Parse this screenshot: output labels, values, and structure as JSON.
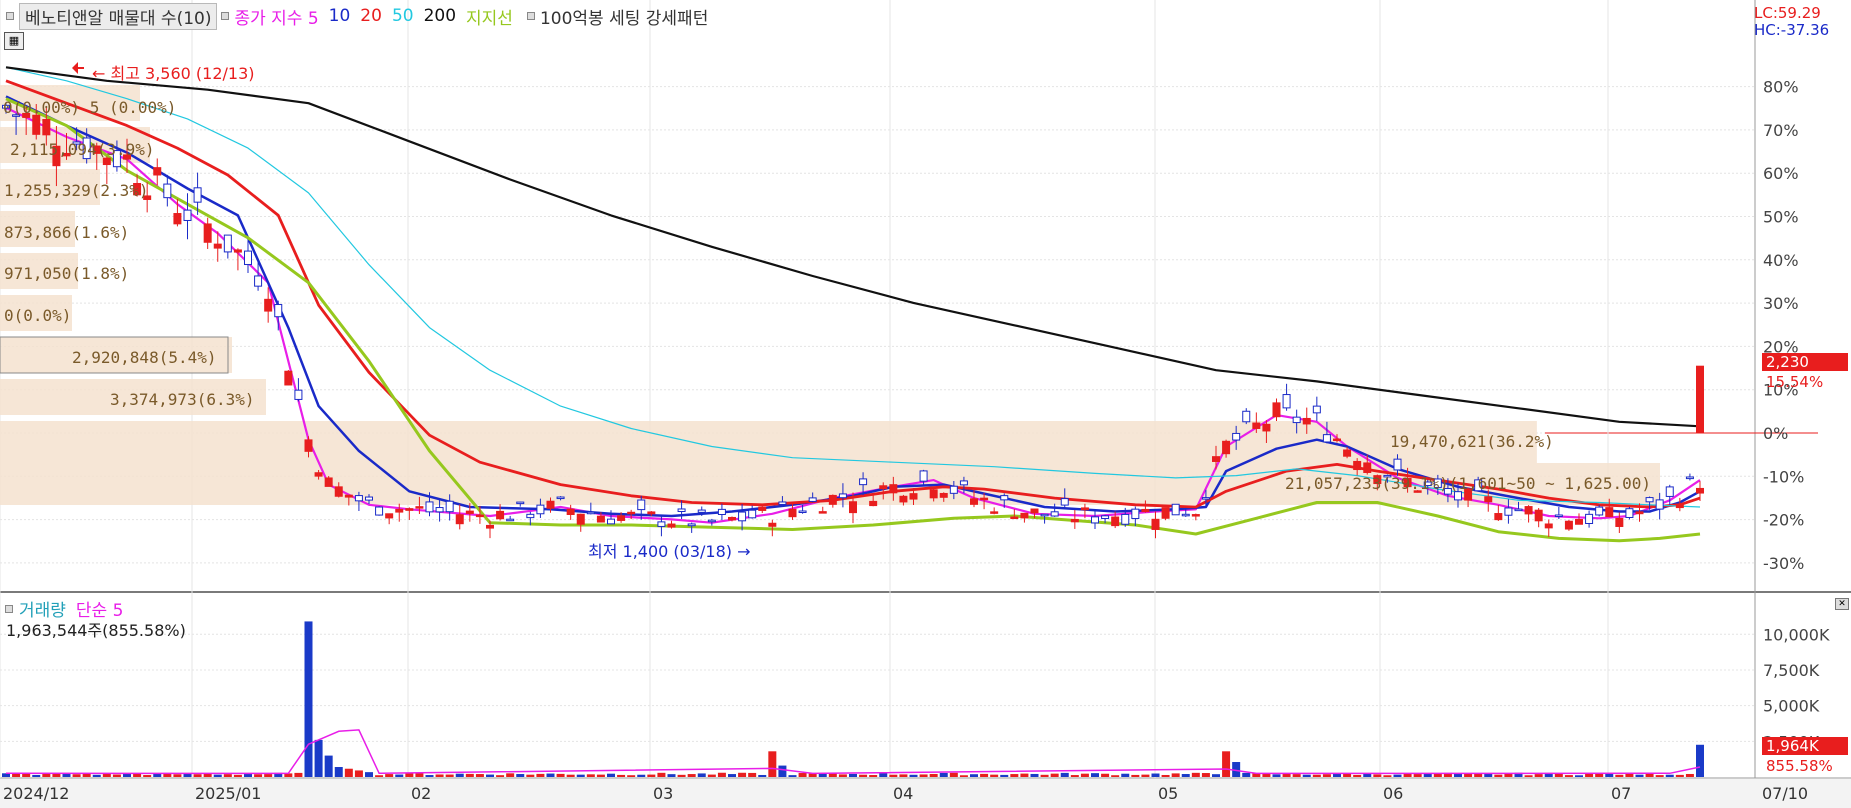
{
  "legend": {
    "title": "베노티앤알 매물대 수(10)",
    "items": [
      {
        "label": "종가 지수 5",
        "color": "#e81ee8"
      },
      {
        "label": "10",
        "color": "#1a2ac8"
      },
      {
        "label": "20",
        "color": "#e81e1e"
      },
      {
        "label": "50",
        "color": "#22c8e0"
      },
      {
        "label": "200",
        "color": "#111111"
      },
      {
        "label": "지지선",
        "color": "#96c81e"
      },
      {
        "label": "100억봉 세팅 강세패턴",
        "color": "#333333"
      }
    ]
  },
  "lc_label": "LC:59.29",
  "hc_label": "HC:-37.36",
  "price_tag": "2,230",
  "pct_tag": "15.54%",
  "volume_legend": {
    "label1": "거래량",
    "label2": "단순 5"
  },
  "volume_info": "1,963,544주(855.58%)",
  "volume_tag": "1,964K",
  "volume_pct_tag": "855.58%",
  "annotations": {
    "high": "최고 3,560 (12/13)",
    "low": "최저 1,400 (03/18)"
  },
  "profile_labels": [
    "0(0.00%) 5 (0.00%)",
    "2,115,094(3.9%)",
    "1,255,329(2.3%)",
    "873,866(1.6%)",
    "971,050(1.8%)",
    "0(0.0%)",
    "2,920,848(5.4%)",
    "3,374,973(6.3%)",
    "19,470,621(36.2%)",
    "21,057,233(39.1%)(1,601~50 ~ 1,625.00)"
  ],
  "chart_data": {
    "type": "candlestick+volume",
    "price_axis_ticks": [
      "80%",
      "70%",
      "60%",
      "50%",
      "40%",
      "30%",
      "20%",
      "10%",
      "0%",
      "-10%",
      "-20%",
      "-30%"
    ],
    "volume_axis_ticks": [
      "10,000K",
      "7,500K",
      "5,000K",
      "2,500K"
    ],
    "x_tick_labels": [
      "2024/12",
      "2025/01",
      "02",
      "03",
      "04",
      "05",
      "06",
      "07",
      "07/10"
    ],
    "price_ylim_pct": [
      -37.36,
      59.29
    ],
    "reference_price": 1930,
    "high": {
      "price": 3560,
      "date": "12/13"
    },
    "low": {
      "price": 1400,
      "date": "03/18"
    },
    "last_close": 2230,
    "last_change_pct": 15.54,
    "last_volume": 1963544,
    "last_volume_ratio_pct": 855.58,
    "volume_profile": [
      {
        "value": 0,
        "pct": 0.0
      },
      {
        "value": 2115094,
        "pct": 3.9
      },
      {
        "value": 1255329,
        "pct": 2.3
      },
      {
        "value": 873866,
        "pct": 1.6
      },
      {
        "value": 971050,
        "pct": 1.8
      },
      {
        "value": 0,
        "pct": 0.0
      },
      {
        "value": 2920848,
        "pct": 5.4
      },
      {
        "value": 3374973,
        "pct": 6.3
      },
      {
        "value": 19470621,
        "pct": 36.2
      },
      {
        "value": 21057233,
        "pct": 39.1
      }
    ],
    "series": [
      {
        "name": "5",
        "points": [
          [
            0,
            3380
          ],
          [
            6,
            3250
          ],
          [
            12,
            3150
          ],
          [
            17,
            2950
          ],
          [
            21,
            2820
          ],
          [
            26,
            2600
          ],
          [
            30,
            1900
          ],
          [
            32,
            1700
          ],
          [
            36,
            1610
          ],
          [
            40,
            1590
          ],
          [
            48,
            1560
          ],
          [
            55,
            1600
          ],
          [
            60,
            1560
          ],
          [
            66,
            1545
          ],
          [
            70,
            1530
          ],
          [
            76,
            1570
          ],
          [
            82,
            1640
          ],
          [
            88,
            1690
          ],
          [
            92,
            1720
          ],
          [
            96,
            1640
          ],
          [
            102,
            1570
          ],
          [
            108,
            1560
          ],
          [
            114,
            1580
          ],
          [
            118,
            1590
          ],
          [
            121,
            1870
          ],
          [
            126,
            2010
          ],
          [
            130,
            1980
          ],
          [
            133,
            1870
          ],
          [
            138,
            1730
          ],
          [
            143,
            1650
          ],
          [
            148,
            1610
          ],
          [
            153,
            1560
          ],
          [
            158,
            1550
          ],
          [
            161,
            1560
          ],
          [
            165,
            1630
          ],
          [
            168,
            1720
          ]
        ]
      },
      {
        "name": "10",
        "points": [
          [
            0,
            3430
          ],
          [
            6,
            3300
          ],
          [
            12,
            3180
          ],
          [
            18,
            3020
          ],
          [
            23,
            2900
          ],
          [
            28,
            2400
          ],
          [
            31,
            2050
          ],
          [
            35,
            1850
          ],
          [
            40,
            1670
          ],
          [
            46,
            1600
          ],
          [
            54,
            1590
          ],
          [
            60,
            1570
          ],
          [
            66,
            1560
          ],
          [
            72,
            1580
          ],
          [
            78,
            1610
          ],
          [
            84,
            1650
          ],
          [
            88,
            1690
          ],
          [
            93,
            1700
          ],
          [
            97,
            1660
          ],
          [
            103,
            1600
          ],
          [
            110,
            1580
          ],
          [
            116,
            1590
          ],
          [
            119,
            1600
          ],
          [
            121,
            1760
          ],
          [
            126,
            1860
          ],
          [
            130,
            1900
          ],
          [
            133,
            1870
          ],
          [
            138,
            1770
          ],
          [
            144,
            1690
          ],
          [
            150,
            1640
          ],
          [
            155,
            1600
          ],
          [
            160,
            1580
          ],
          [
            163,
            1580
          ],
          [
            166,
            1620
          ],
          [
            168,
            1670
          ]
        ]
      },
      {
        "name": "20",
        "points": [
          [
            0,
            3500
          ],
          [
            6,
            3400
          ],
          [
            12,
            3300
          ],
          [
            17,
            3200
          ],
          [
            22,
            3080
          ],
          [
            27,
            2900
          ],
          [
            31,
            2500
          ],
          [
            36,
            2200
          ],
          [
            42,
            1920
          ],
          [
            47,
            1800
          ],
          [
            55,
            1700
          ],
          [
            62,
            1650
          ],
          [
            68,
            1620
          ],
          [
            75,
            1610
          ],
          [
            82,
            1630
          ],
          [
            88,
            1670
          ],
          [
            93,
            1690
          ],
          [
            97,
            1680
          ],
          [
            104,
            1640
          ],
          [
            112,
            1610
          ],
          [
            118,
            1600
          ],
          [
            121,
            1670
          ],
          [
            127,
            1760
          ],
          [
            132,
            1790
          ],
          [
            136,
            1760
          ],
          [
            142,
            1720
          ],
          [
            148,
            1680
          ],
          [
            153,
            1640
          ],
          [
            158,
            1610
          ],
          [
            163,
            1600
          ],
          [
            166,
            1610
          ],
          [
            168,
            1640
          ]
        ]
      },
      {
        "name": "50",
        "points": [
          [
            0,
            3560
          ],
          [
            6,
            3500
          ],
          [
            12,
            3420
          ],
          [
            18,
            3330
          ],
          [
            24,
            3200
          ],
          [
            30,
            3000
          ],
          [
            36,
            2680
          ],
          [
            42,
            2400
          ],
          [
            48,
            2210
          ],
          [
            55,
            2050
          ],
          [
            62,
            1950
          ],
          [
            70,
            1870
          ],
          [
            78,
            1820
          ],
          [
            88,
            1800
          ],
          [
            98,
            1780
          ],
          [
            108,
            1750
          ],
          [
            116,
            1730
          ],
          [
            122,
            1740
          ],
          [
            128,
            1770
          ],
          [
            134,
            1740
          ],
          [
            142,
            1680
          ],
          [
            150,
            1630
          ],
          [
            158,
            1620
          ],
          [
            163,
            1610
          ],
          [
            168,
            1600
          ]
        ]
      },
      {
        "name": "200",
        "points": [
          [
            0,
            3560
          ],
          [
            10,
            3500
          ],
          [
            20,
            3460
          ],
          [
            30,
            3400
          ],
          [
            40,
            3230
          ],
          [
            50,
            3060
          ],
          [
            60,
            2900
          ],
          [
            70,
            2760
          ],
          [
            80,
            2630
          ],
          [
            90,
            2510
          ],
          [
            100,
            2410
          ],
          [
            110,
            2310
          ],
          [
            120,
            2210
          ],
          [
            130,
            2160
          ],
          [
            140,
            2100
          ],
          [
            150,
            2040
          ],
          [
            160,
            1980
          ],
          [
            168,
            1960
          ]
        ]
      },
      {
        "name": "지지선",
        "points": [
          [
            0,
            3420
          ],
          [
            6,
            3300
          ],
          [
            12,
            3100
          ],
          [
            18,
            2950
          ],
          [
            24,
            2800
          ],
          [
            30,
            2600
          ],
          [
            36,
            2250
          ],
          [
            42,
            1850
          ],
          [
            48,
            1530
          ],
          [
            55,
            1520
          ],
          [
            62,
            1520
          ],
          [
            70,
            1510
          ],
          [
            78,
            1500
          ],
          [
            86,
            1520
          ],
          [
            94,
            1550
          ],
          [
            100,
            1560
          ],
          [
            106,
            1540
          ],
          [
            112,
            1520
          ],
          [
            118,
            1480
          ],
          [
            124,
            1550
          ],
          [
            130,
            1620
          ],
          [
            136,
            1620
          ],
          [
            142,
            1560
          ],
          [
            148,
            1490
          ],
          [
            154,
            1460
          ],
          [
            160,
            1450
          ],
          [
            164,
            1460
          ],
          [
            168,
            1480
          ]
        ]
      }
    ]
  }
}
